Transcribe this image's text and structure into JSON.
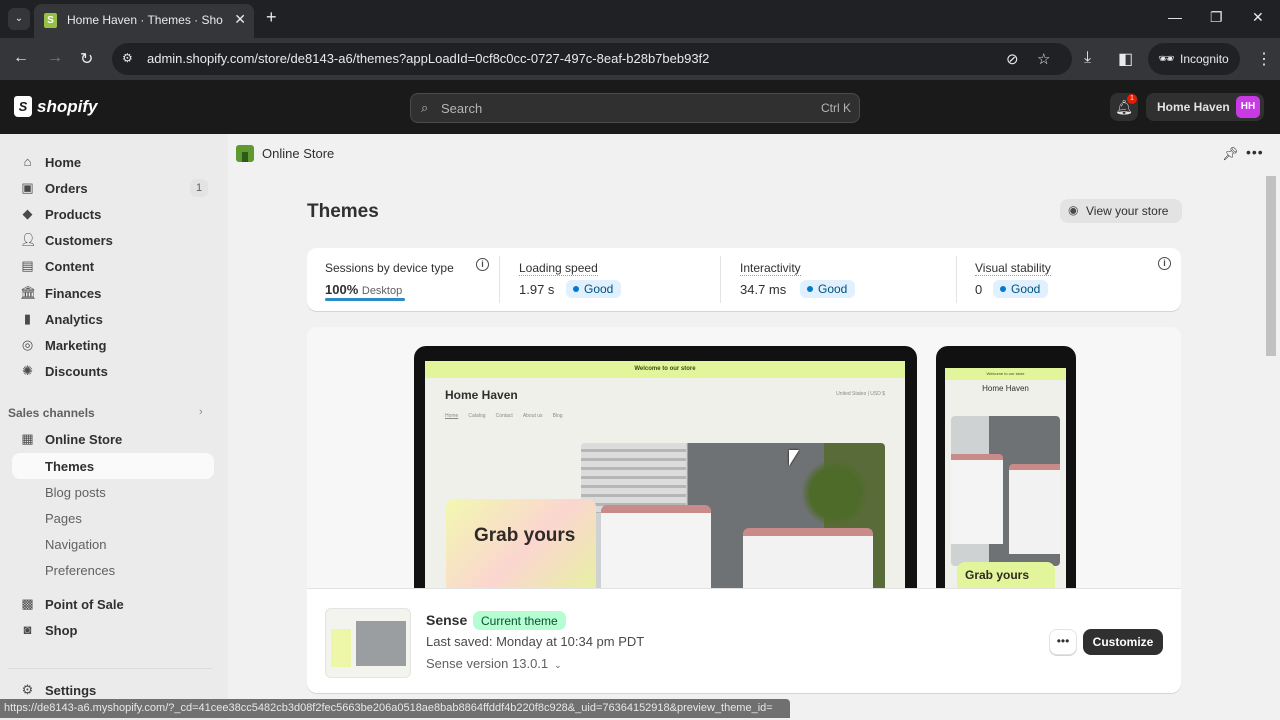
{
  "browser": {
    "tab_title": "Home Haven · Themes · Shopify",
    "url": "admin.shopify.com/store/de8143-a6/themes?appLoadId=0cf8c0cc-0727-497c-8eaf-b28b7beb93f2",
    "incognito_label": "Incognito",
    "status_url": "https://de8143-a6.myshopify.com/?_cd=41cee38cc5482cb3d08f2fec5663be206a0518ae8bab8864ffddf4b220f8c928&_uid=76364152918&preview_theme_id="
  },
  "topbar": {
    "logo_text": "shopify",
    "search_placeholder": "Search",
    "search_shortcut": "Ctrl K",
    "notification_count": "1",
    "store_name": "Home Haven",
    "avatar_initials": "HH",
    "avatar_color": "#c73ae4"
  },
  "sidebar": {
    "items": [
      {
        "label": "Home",
        "icon": "home-icon"
      },
      {
        "label": "Orders",
        "icon": "orders-icon",
        "count": "1"
      },
      {
        "label": "Products",
        "icon": "tag-icon"
      },
      {
        "label": "Customers",
        "icon": "person-icon"
      },
      {
        "label": "Content",
        "icon": "content-icon"
      },
      {
        "label": "Finances",
        "icon": "bank-icon"
      },
      {
        "label": "Analytics",
        "icon": "bar-chart-icon"
      },
      {
        "label": "Marketing",
        "icon": "target-icon"
      },
      {
        "label": "Discounts",
        "icon": "discount-icon"
      }
    ],
    "sales_channels_label": "Sales channels",
    "channels": [
      {
        "label": "Online Store",
        "icon": "store-icon"
      }
    ],
    "online_store_sub": [
      {
        "label": "Themes",
        "active": true
      },
      {
        "label": "Blog posts"
      },
      {
        "label": "Pages"
      },
      {
        "label": "Navigation"
      },
      {
        "label": "Preferences"
      }
    ],
    "apps": [
      {
        "label": "Point of Sale",
        "icon": "pos-icon"
      },
      {
        "label": "Shop",
        "icon": "shop-icon"
      }
    ],
    "settings_label": "Settings"
  },
  "main": {
    "breadcrumb": "Online Store",
    "title": "Themes",
    "view_store_label": "View your store",
    "metrics": {
      "sessions": {
        "label": "Sessions by device type",
        "value": "100%",
        "device": "Desktop",
        "share_percent": 100
      },
      "loading_speed": {
        "label": "Loading speed",
        "value": "1.97 s",
        "status": "Good"
      },
      "interactivity": {
        "label": "Interactivity",
        "value": "34.7 ms",
        "status": "Good"
      },
      "visual_stability": {
        "label": "Visual stability",
        "value": "0",
        "status": "Good"
      }
    },
    "preview": {
      "announcement": "Welcome to our store",
      "store_title": "Home Haven",
      "nav": [
        "Home",
        "Catalog",
        "Contact",
        "About us",
        "Blog"
      ],
      "currency": "United States | USD $",
      "hero_text": "Grab yours",
      "mobile_title": "Home Haven",
      "mobile_hero_text": "Grab yours"
    },
    "theme": {
      "name": "Sense",
      "badge": "Current theme",
      "last_saved": "Last saved: Monday at 10:34 pm PDT",
      "version": "Sense version 13.0.1",
      "more_label": "•••",
      "customize_label": "Customize"
    }
  }
}
